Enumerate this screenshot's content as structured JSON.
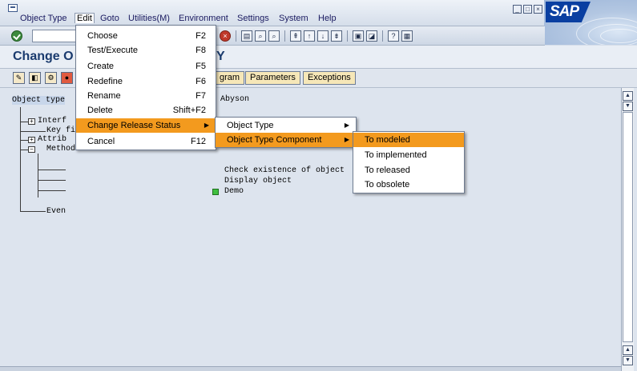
{
  "menubar": {
    "items": [
      {
        "label": "Object Type"
      },
      {
        "label": "Edit"
      },
      {
        "label": "Goto"
      },
      {
        "label": "Utilities(M)"
      },
      {
        "label": "Environment"
      },
      {
        "label": "Settings"
      },
      {
        "label": "System"
      },
      {
        "label": "Help"
      }
    ]
  },
  "logo": {
    "text": "SAP"
  },
  "title": {
    "left": "Change O",
    "right": "Y"
  },
  "app_toolbar": {
    "buttons": [
      {
        "label": "gram"
      },
      {
        "label": "Parameters"
      },
      {
        "label": "Exceptions"
      }
    ]
  },
  "tree": {
    "root": "Object type",
    "owner": "Abyson",
    "nodes": {
      "interfaces": "Interf",
      "key_fields": "Key fi",
      "attributes": "Attrib",
      "methods": "Methods",
      "events": "Even"
    },
    "method_items": [
      "Check existence of object",
      "Display object",
      "Demo"
    ]
  },
  "edit_menu": {
    "items": [
      {
        "label": "Choose",
        "shortcut": "F2"
      },
      {
        "label": "Test/Execute",
        "shortcut": "F8"
      },
      {
        "label": "Create",
        "shortcut": "F5"
      },
      {
        "label": "Redefine",
        "shortcut": "F6"
      },
      {
        "label": "Rename",
        "shortcut": "F7"
      },
      {
        "label": "Delete",
        "shortcut": "Shift+F2"
      },
      {
        "label": "Change Release Status",
        "shortcut": ""
      },
      {
        "label": "Cancel",
        "shortcut": "F12"
      }
    ]
  },
  "release_menu": {
    "items": [
      {
        "label": "Object Type"
      },
      {
        "label": "Object Type Component"
      }
    ]
  },
  "component_menu": {
    "items": [
      {
        "label": "To modeled"
      },
      {
        "label": "To implemented"
      },
      {
        "label": "To released"
      },
      {
        "label": "To obsolete"
      }
    ]
  },
  "colors": {
    "highlight": "#f39a1e",
    "title": "#1b3b6e",
    "sap_blue": "#0a3fa1"
  }
}
